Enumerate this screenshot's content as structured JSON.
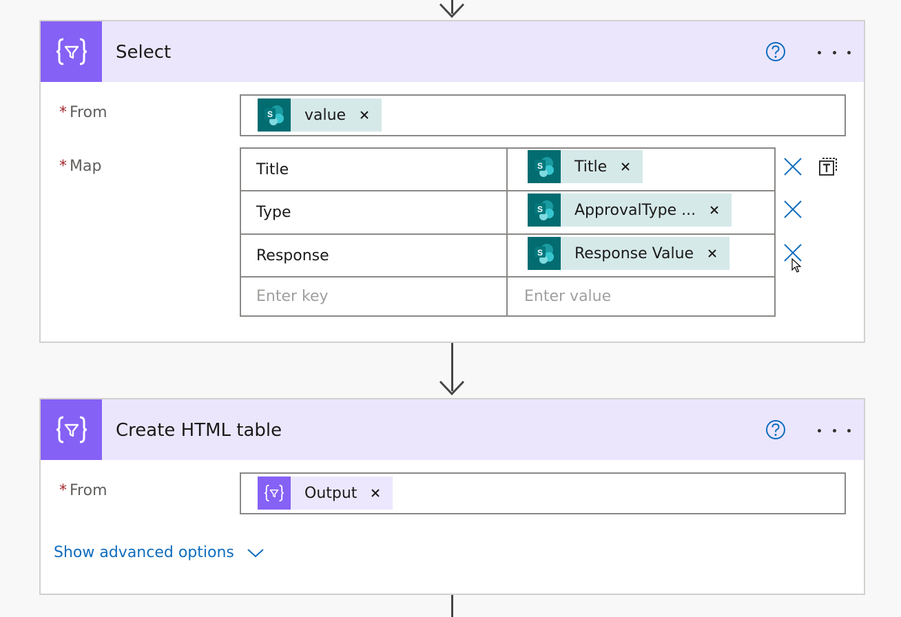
{
  "colors": {
    "op_purple": "#8661f5",
    "header_bg": "#ebe6fc",
    "sharepoint_teal": "#036c70",
    "token_teal_bg": "#d6e9e9",
    "link_blue": "#0f6cbd",
    "required_red": "#a4262c"
  },
  "icons": {
    "operation": "data-operation-icon",
    "sharepoint": "sharepoint-icon",
    "help": "help-circle-icon",
    "more": "more-dots-icon",
    "remove": "close-icon",
    "switch_mode": "switch-to-text-mode-icon",
    "chevron": "chevron-down-icon"
  },
  "select_action": {
    "title": "Select",
    "from_label": "From",
    "required_mark": "*",
    "from_token": "value",
    "map_label": "Map",
    "map_rows": [
      {
        "key": "Title",
        "value_token": "Title"
      },
      {
        "key": "Type",
        "value_token": "ApprovalType ..."
      },
      {
        "key": "Response",
        "value_token": "Response Value"
      }
    ],
    "key_placeholder": "Enter key",
    "value_placeholder": "Enter value"
  },
  "html_table_action": {
    "title": "Create HTML table",
    "from_label": "From",
    "required_mark": "*",
    "from_token": "Output",
    "advanced_label": "Show advanced options"
  },
  "token_remove_glyph": "×"
}
